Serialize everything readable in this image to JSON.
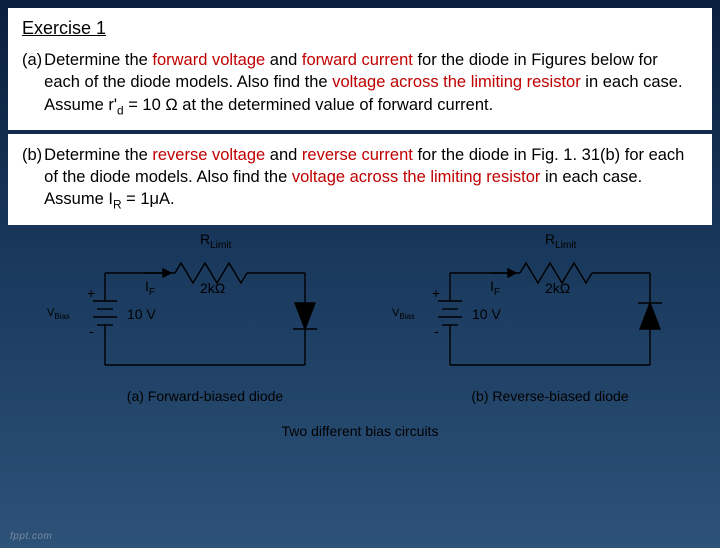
{
  "title": "Exercise 1",
  "partA": {
    "label": "(a)",
    "seg1": "Determine the ",
    "hl1": "forward voltage",
    "seg2": " and ",
    "hl2": "forward current",
    "seg3": " for the diode in  Figures below for each of the diode models. Also find the ",
    "hl3": "voltage  across the limiting resistor",
    "seg4": " in each case. Assume r'",
    "sub1": "d",
    "seg5": " = 10 Ω at the  determined value of forward current."
  },
  "partB": {
    "label": "(b)",
    "seg1": "Determine the ",
    "hl1": "reverse voltage",
    "seg2": " and ",
    "hl2": "reverse current",
    "seg3": " for the diode in Fig. 1. 31(b) for each of the diode models. Also find the ",
    "hl3": "voltage across  the limiting resistor",
    "seg4": " in each case. Assume I",
    "sub1": "R",
    "seg5": " = 1μA."
  },
  "circuitA": {
    "rlimit_pre": "R",
    "rlimit_sub": "Limit",
    "if_pre": "I",
    "if_sub": "F",
    "rvalue": "2kΩ",
    "voltage": "10 V",
    "vbias_pre": "V",
    "vbias_sub": "Bias",
    "plus": "+",
    "minus": "-",
    "caption": "(a) Forward-biased diode"
  },
  "circuitB": {
    "rlimit_pre": "R",
    "rlimit_sub": "Limit",
    "if_pre": "I",
    "if_sub": "F",
    "rvalue": "2kΩ",
    "voltage": "10 V",
    "vbias_pre": "V",
    "vbias_sub": "Bias",
    "plus": "+",
    "minus": "-",
    "caption": "(b) Reverse-biased diode"
  },
  "bottomCaption": "Two different bias circuits",
  "footer": "fppt.com"
}
